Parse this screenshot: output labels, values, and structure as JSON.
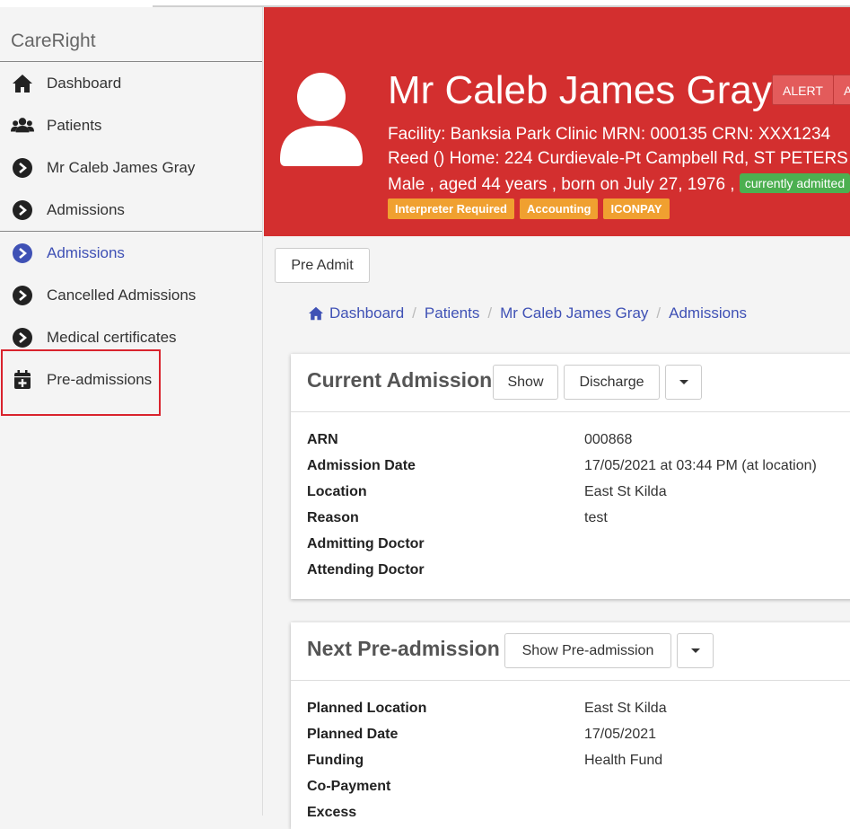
{
  "sidebar": {
    "brand": "CareRight",
    "items": [
      {
        "label": "Dashboard"
      },
      {
        "label": "Patients"
      },
      {
        "label": "Mr Caleb James Gray"
      },
      {
        "label": "Admissions"
      }
    ],
    "sub_items": [
      {
        "label": "Admissions"
      },
      {
        "label": "Cancelled Admissions"
      },
      {
        "label": "Medical certificates"
      },
      {
        "label": "Pre-admissions"
      }
    ]
  },
  "header": {
    "patient_name": "Mr Caleb James Gray",
    "alert_buttons": [
      "ALERT",
      "A"
    ],
    "line1": "Facility: Banksia Park Clinic    MRN: 000135    CRN: XXX1234",
    "line2": "Reed ()    Home: 224 Curdievale-Pt Campbell Rd, ST PETERS",
    "line3": "Male , aged 44 years , born on July 27, 1976 ,",
    "status_badge": "currently admitted",
    "tags": [
      "Interpreter Required",
      "Accounting",
      "ICONPAY"
    ]
  },
  "toolbar": {
    "pre_admit_label": "Pre Admit"
  },
  "breadcrumb": [
    "Dashboard",
    "Patients",
    "Mr Caleb James Gray",
    "Admissions"
  ],
  "current_admission": {
    "title": "Current Admission",
    "show_label": "Show",
    "discharge_label": "Discharge",
    "fields": [
      {
        "label": "ARN",
        "value": "000868"
      },
      {
        "label": "Admission Date",
        "value": "17/05/2021 at 03:44 PM (at location)"
      },
      {
        "label": "Location",
        "value": "East St Kilda"
      },
      {
        "label": "Reason",
        "value": "test"
      },
      {
        "label": "Admitting Doctor",
        "value": ""
      },
      {
        "label": "Attending Doctor",
        "value": ""
      }
    ]
  },
  "next_preadmission": {
    "title": "Next Pre-admission",
    "show_label": "Show Pre-admission",
    "fields": [
      {
        "label": "Planned Location",
        "value": "East St Kilda"
      },
      {
        "label": "Planned Date",
        "value": "17/05/2021"
      },
      {
        "label": "Funding",
        "value": "Health Fund"
      },
      {
        "label": "Co-Payment",
        "value": ""
      },
      {
        "label": "Excess",
        "value": ""
      }
    ]
  },
  "colors": {
    "header_red": "#d32f2f",
    "link_blue": "#3f51b5",
    "tag_orange": "#f0a030",
    "badge_green": "#4caf50"
  }
}
